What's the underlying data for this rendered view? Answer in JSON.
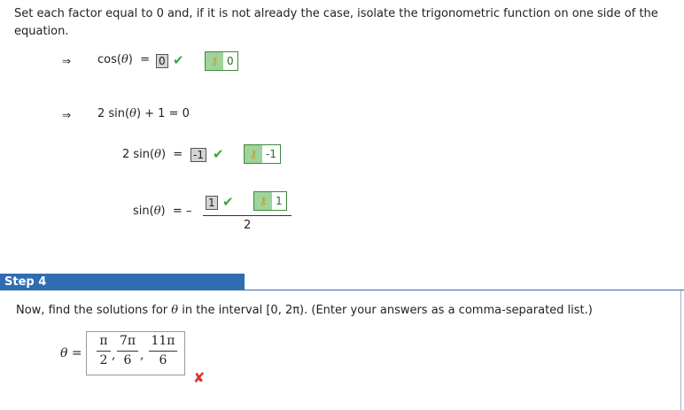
{
  "intro_text": "Set each factor equal to 0 and, if it is not already the case, isolate the trigonometric function on one side of the equation.",
  "implies_symbol": "⇒",
  "eq1": {
    "lhs": "cos(",
    "var": "θ",
    "rhs_close": ")",
    "equals": "=",
    "answer": "0",
    "key_value": "0"
  },
  "eq2": {
    "text_pre": "2 sin(",
    "var": "θ",
    "text_post": ") + 1 = 0"
  },
  "eq3": {
    "lhs": "2 sin(",
    "var": "θ",
    "rhs_close": ")",
    "equals": "=",
    "answer": "-1",
    "key_value": "-1"
  },
  "eq4": {
    "lhs": "sin(",
    "var": "θ",
    "rhs_close": ")",
    "equals": "=",
    "minus": "–",
    "numerator_answer": "1",
    "key_value": "1",
    "denominator": "2"
  },
  "step": {
    "label": "Step 4"
  },
  "prompt": {
    "text_pre": "Now, find the solutions for ",
    "var": "θ",
    "text_post": " in the interval  [0, 2π).  (Enter your answers as a comma-separated list.)"
  },
  "answer": {
    "var_label": "θ =",
    "fractions": [
      {
        "num": "π",
        "den": "2"
      },
      {
        "num": "7π",
        "den": "6"
      },
      {
        "num": "11π",
        "den": "6"
      }
    ],
    "separator": ","
  },
  "icons": {
    "check": "check-icon",
    "key": "key-icon",
    "incorrect": "incorrect-x-icon"
  },
  "colors": {
    "check": "#3ea63e",
    "incorrect": "#e03030",
    "step_header": "#2f6db3",
    "key_bg": "#9fd39a"
  }
}
